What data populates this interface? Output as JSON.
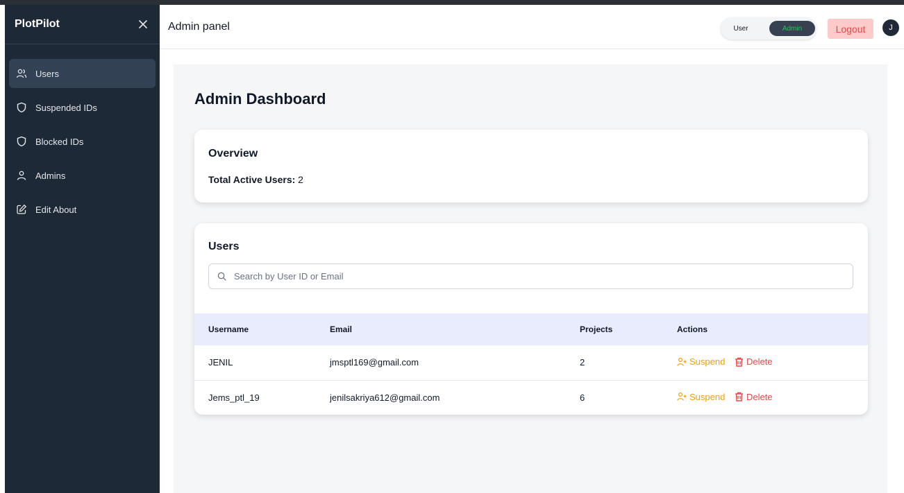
{
  "sidebar": {
    "brand": "PlotPilot",
    "items": [
      {
        "label": "Users",
        "icon": "users-icon",
        "active": true
      },
      {
        "label": "Suspended IDs",
        "icon": "shield-icon"
      },
      {
        "label": "Blocked IDs",
        "icon": "shield-icon"
      },
      {
        "label": "Admins",
        "icon": "user-icon"
      },
      {
        "label": "Edit About",
        "icon": "edit-icon"
      }
    ]
  },
  "header": {
    "title": "Admin panel",
    "toggle": {
      "user_label": "User",
      "admin_label": "Admin",
      "selected": "Admin"
    },
    "logout_label": "Logout",
    "avatar_initial": "J"
  },
  "main": {
    "page_title": "Admin Dashboard",
    "overview": {
      "title": "Overview",
      "stat_label": "Total Active Users:",
      "stat_value": "2"
    },
    "users": {
      "title": "Users",
      "search_placeholder": "Search by User ID or Email",
      "columns": [
        "Username",
        "Email",
        "Projects",
        "Actions"
      ],
      "rows": [
        {
          "username": "JENIL",
          "email": "jmsptl169@gmail.com",
          "projects": "2"
        },
        {
          "username": "Jems_ptl_19",
          "email": "jenilsakriya612@gmail.com",
          "projects": "6"
        }
      ],
      "suspend_label": "Suspend",
      "delete_label": "Delete"
    }
  },
  "colors": {
    "sidebar_bg": "#1e2937",
    "active_item_bg": "#334155",
    "suspend": "#f59e0b",
    "delete": "#ef4444",
    "logout_bg": "#fecaca",
    "table_header_bg": "#e8ecfc"
  }
}
